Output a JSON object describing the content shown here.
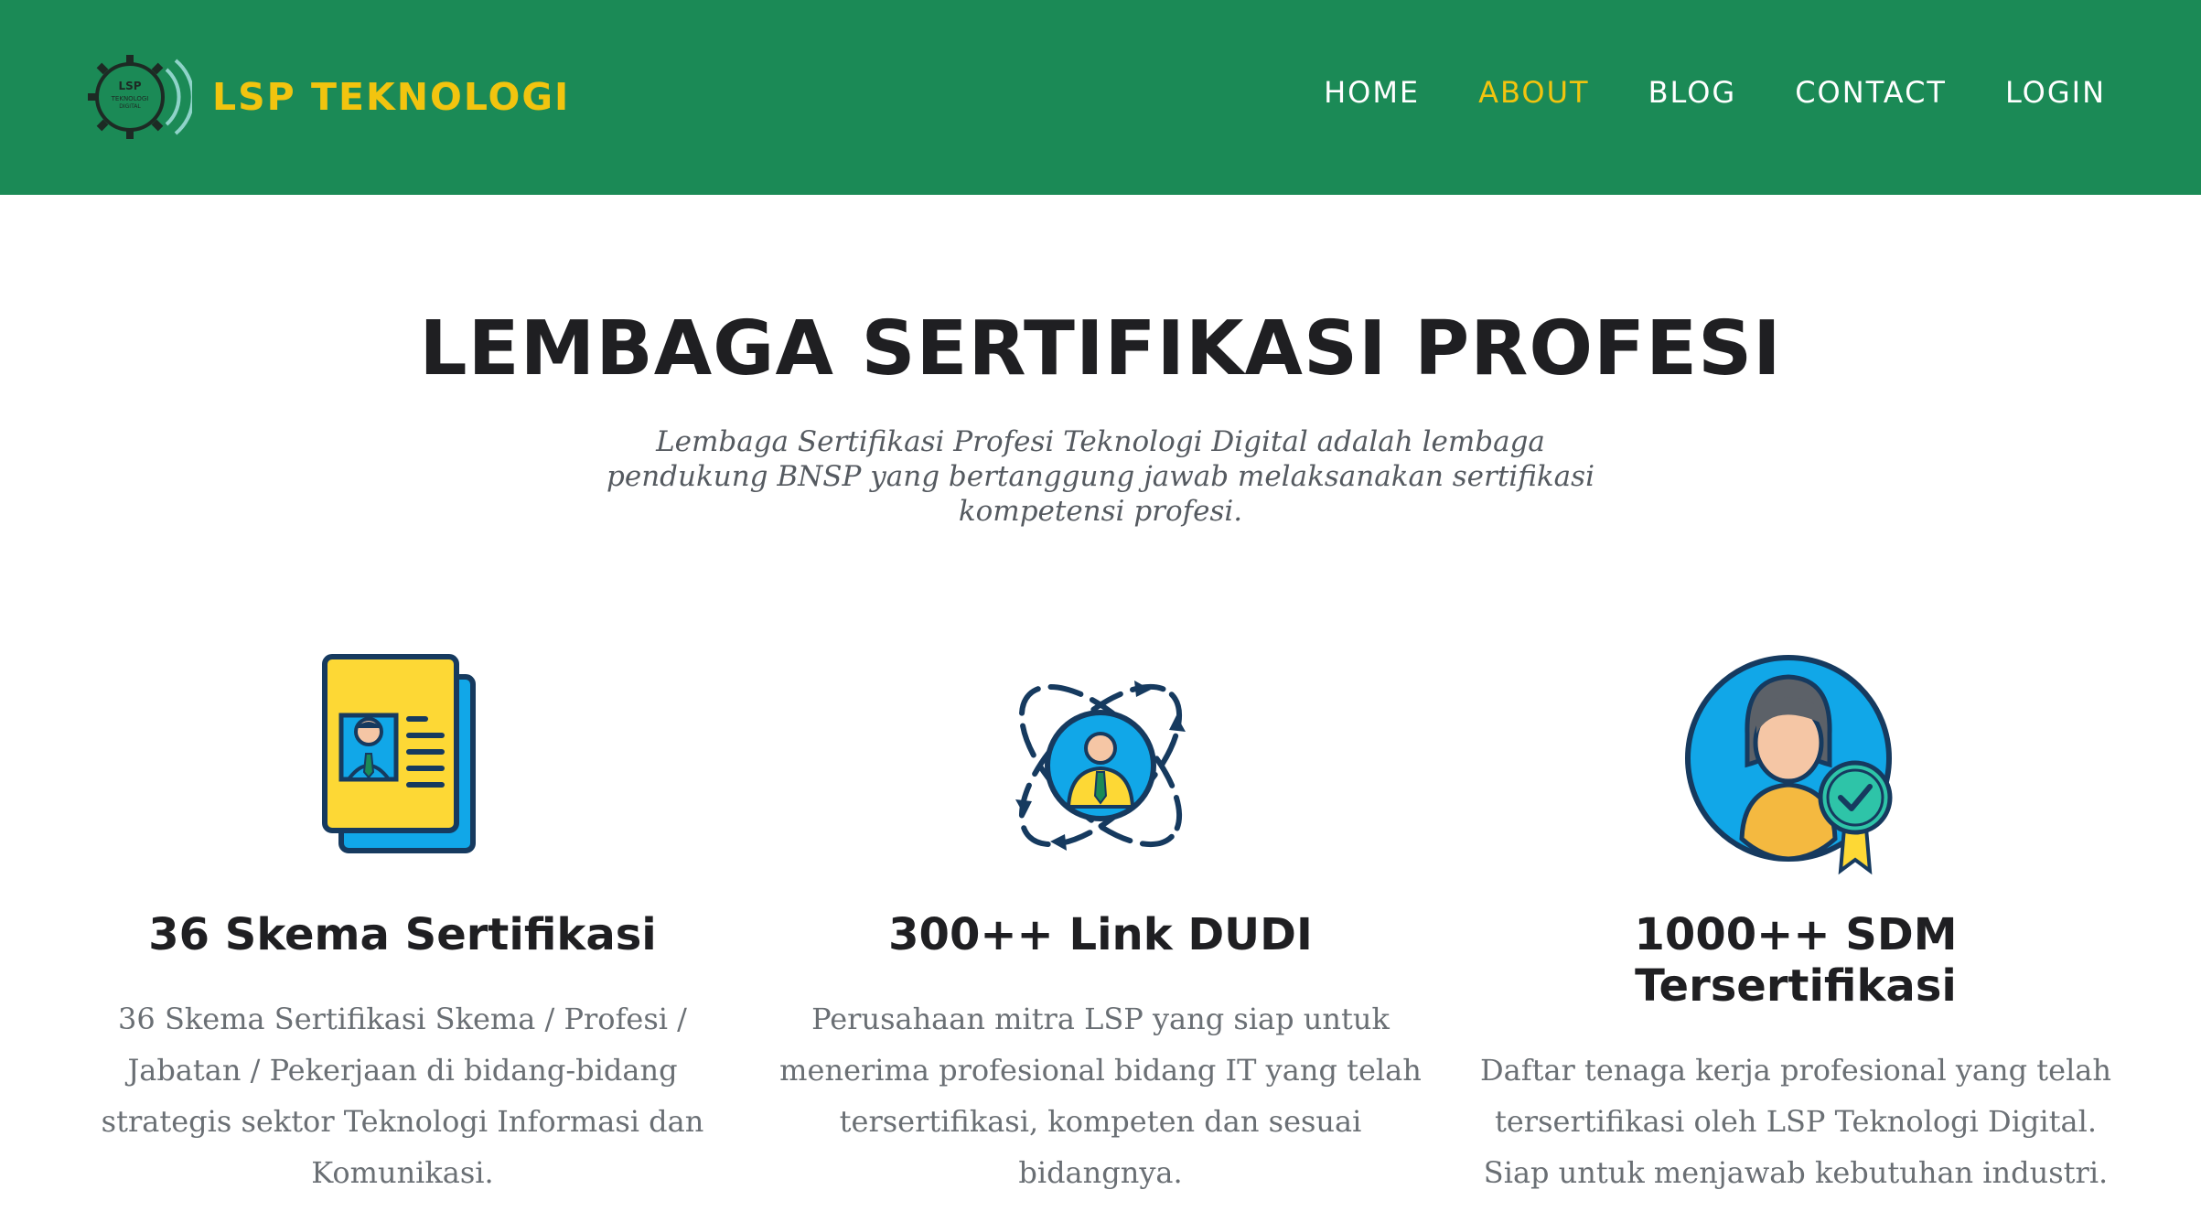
{
  "brand": {
    "name": "LSP TEKNOLOGI",
    "logo_text_1": "LSP",
    "logo_text_2": "TEKNOLOGI",
    "logo_text_3": "DIGITAL"
  },
  "nav": {
    "items": [
      {
        "label": "HOME",
        "active": false
      },
      {
        "label": "ABOUT",
        "active": true
      },
      {
        "label": "BLOG",
        "active": false
      },
      {
        "label": "CONTACT",
        "active": false
      },
      {
        "label": "LOGIN",
        "active": false
      }
    ]
  },
  "hero": {
    "title": "LEMBAGA SERTIFIKASI PROFESI",
    "subtitle": "Lembaga Sertifikasi Profesi Teknologi Digital adalah lembaga pendukung BNSP yang bertanggung jawab melaksanakan sertifikasi kompetensi profesi."
  },
  "features": [
    {
      "icon": "certificate-document-icon",
      "title": "36 Skema Sertifikasi",
      "description": "36 Skema Sertifikasi Skema / Profesi / Jabatan / Pekerjaan di bidang-bidang strategis sektor Teknologi Informasi dan Komunikasi."
    },
    {
      "icon": "network-person-icon",
      "title": "300++ Link DUDI",
      "description": "Perusahaan mitra LSP yang siap untuk menerima profesional bidang IT yang telah tersertifikasi, kompeten dan sesuai bidangnya."
    },
    {
      "icon": "certified-person-icon",
      "title": "1000++ SDM Tersertifikasi",
      "description": "Daftar tenaga kerja profesional yang telah tersertifikasi oleh LSP Teknologi Digital. Siap untuk menjawab kebutuhan industri."
    }
  ],
  "colors": {
    "navbar": "#1b8a56",
    "accent": "#f2c40f",
    "title": "#1f1f22",
    "body_text": "#6a6f74"
  }
}
